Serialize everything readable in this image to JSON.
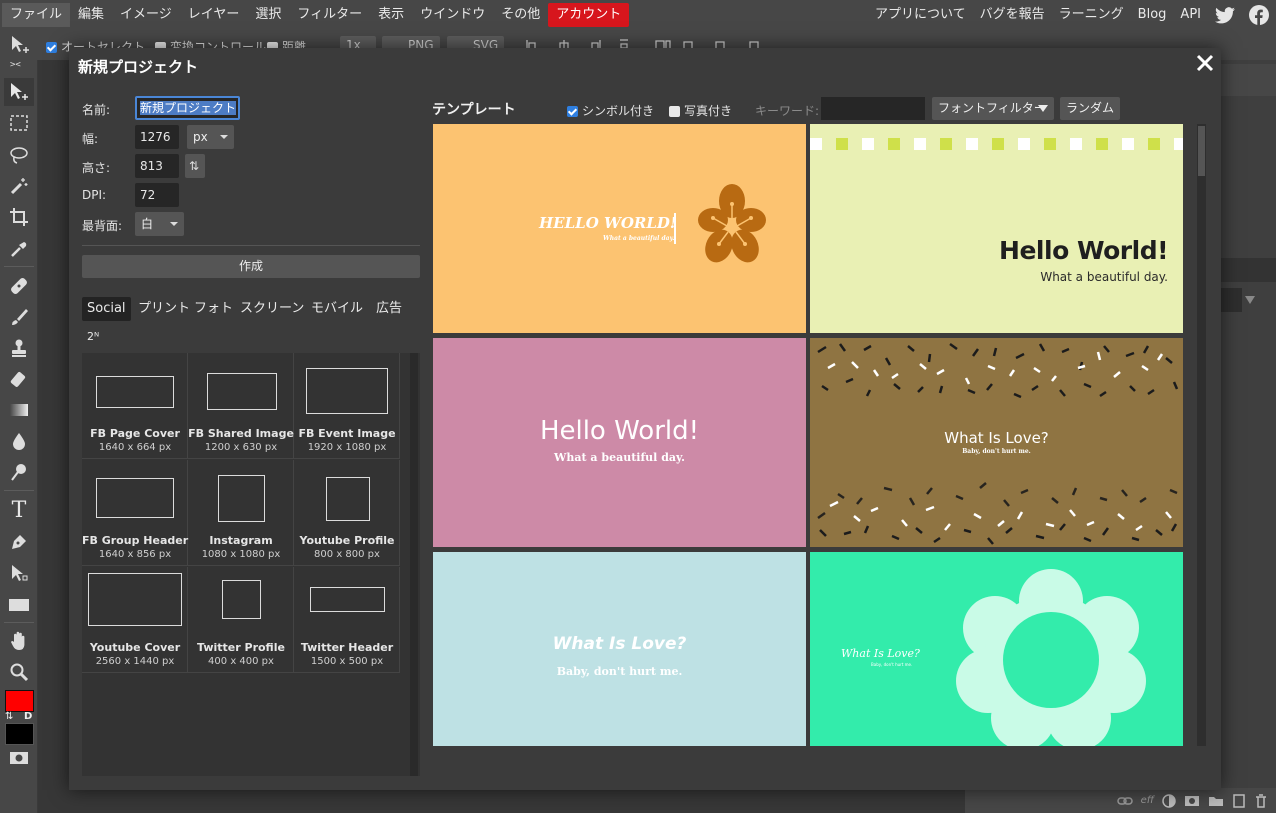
{
  "menu": {
    "items": [
      "ファイル",
      "編集",
      "イメージ",
      "レイヤー",
      "選択",
      "フィルター",
      "表示",
      "ウインドウ",
      "その他"
    ],
    "account_label": "アカウント",
    "right_items": [
      "アプリについて",
      "バグを報告",
      "ラーニング",
      "Blog",
      "API"
    ],
    "icons": [
      "twitter-icon",
      "facebook-icon"
    ]
  },
  "optbar": {
    "autoselect": "オートセレクト",
    "transform": "変換コントロール",
    "distance": "距離",
    "zoom": "1x",
    "png": "PNG",
    "svg": "SVG"
  },
  "dialog": {
    "title": "新規プロジェクト",
    "fields": {
      "name_label": "名前:",
      "name_value": "新規プロジェクト",
      "width_label": "幅:",
      "width_value": "1276",
      "unit": "px",
      "height_label": "高さ:",
      "height_value": "813",
      "dpi_label": "DPI:",
      "dpi_value": "72",
      "background_label": "最背面:",
      "background_value": "白"
    },
    "create_label": "作成",
    "categories": [
      "Social",
      "プリント",
      "フォト",
      "スクリーン",
      "モバイル",
      "広告",
      "2ᴺ"
    ],
    "presets": [
      {
        "name": "FB Page Cover",
        "size": "1640 x 664 px"
      },
      {
        "name": "FB Shared Image",
        "size": "1200 x 630 px"
      },
      {
        "name": "FB Event Image",
        "size": "1920 x 1080 px"
      },
      {
        "name": "FB Group Header",
        "size": "1640 x 856 px"
      },
      {
        "name": "Instagram",
        "size": "1080 x 1080 px"
      },
      {
        "name": "Youtube Profile",
        "size": "800 x 800 px"
      },
      {
        "name": "Youtube Cover",
        "size": "2560 x 1440 px"
      },
      {
        "name": "Twitter Profile",
        "size": "400 x 400 px"
      },
      {
        "name": "Twitter Header",
        "size": "1500 x 500 px"
      }
    ],
    "templates_header": {
      "title": "テンプレート",
      "symbols_label": "シンボル付き",
      "symbols_checked": true,
      "photos_label": "写真付き",
      "photos_checked": false,
      "keyword_label": "キーワード:",
      "keyword_value": "",
      "font_filter": "フォントフィルター",
      "random": "ランダム"
    },
    "templates": [
      {
        "bg": "#fcc371",
        "title": "HELLO WORLD!",
        "sub": "What a beautiful day."
      },
      {
        "bg": "#e9f0b4",
        "title": "Hello World!",
        "sub": "What a beautiful day."
      },
      {
        "bg": "#cd8aa7",
        "title": "Hello World!",
        "sub": "What a beautiful day."
      },
      {
        "bg": "#8f7442",
        "title": "What Is Love?",
        "sub": "Baby, don't hurt me."
      },
      {
        "bg": "#bee1e4",
        "title": "What Is Love?",
        "sub": "Baby, don't hurt me."
      },
      {
        "bg": "#33ecab",
        "title": "What Is Love?",
        "sub": "Baby, don't hurt me."
      }
    ]
  },
  "colors": {
    "foreground": "#ff0000",
    "background": "#000000",
    "accent": "#d7161d",
    "selection": "#4a86d6"
  },
  "swap_colors_label": "D"
}
